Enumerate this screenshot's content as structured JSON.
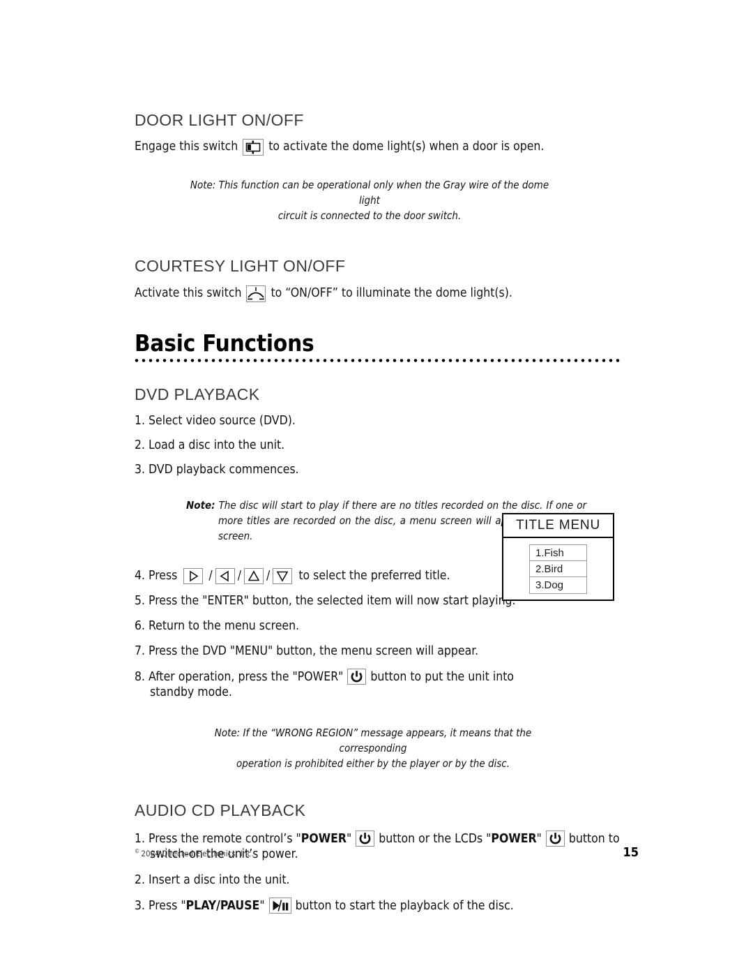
{
  "sections": {
    "door_light": {
      "heading": "DOOR LIGHT ON/OFF",
      "body_before": "Engage this switch",
      "icon": "door-light-switch-icon",
      "body_after": "to activate the dome light(s) when a door is open.",
      "note_line1": "Note: This function can be operational only when the Gray wire of the dome light",
      "note_line2": "circuit is connected to the door switch."
    },
    "courtesy_light": {
      "heading": "COURTESY LIGHT ON/OFF",
      "body_before": "Activate this switch",
      "icon": "courtesy-dome-light-icon",
      "body_after": "to “ON/OFF” to illuminate the dome light(s)."
    },
    "chapter": {
      "title": "Basic Functions"
    },
    "dvd_playback": {
      "heading": "DVD PLAYBACK",
      "steps_1_3": [
        "1. Select video source (DVD).",
        "2. Load a disc into the unit.",
        "3. DVD playback commences."
      ],
      "note_label": "Note:",
      "note_text": "The disc will start to play if there are no titles recorded on the disc. If one or more titles are recorded on the disc, a menu screen will appear on the LCD screen.",
      "step4_num": "4. Press",
      "step4_sep": "/",
      "step4_icons": [
        "arrow-right-icon",
        "arrow-left-icon",
        "arrow-up-icon",
        "arrow-down-icon"
      ],
      "step4_tail": "to select the preferred title.",
      "step5": "5. Press the \"ENTER\" button, the selected item will now start playing.",
      "step6": "6. Return to the menu screen.",
      "step7": "7. Press the DVD \"MENU\" button, the menu screen will appear.",
      "step8_before": "8. After operation, press the \"POWER\"",
      "step8_icon": "power-icon",
      "step8_after": "button to put the unit into standby mode.",
      "note2_line1": "Note: If the “WRONG REGION” message appears, it means that the corresponding",
      "note2_line2": "operation is prohibited either by the player or by the disc."
    },
    "title_menu": {
      "header": "TITLE MENU",
      "items": [
        "1.Fish",
        "2.Bird",
        "3.Dog"
      ]
    },
    "audio_cd": {
      "heading": "AUDIO CD PLAYBACK",
      "step1_a": "1. Press the remote control’s \"",
      "step1_power1": "POWER",
      "step1_b": "\"",
      "step1_icon1": "power-icon",
      "step1_c": "button or the LCDs \"",
      "step1_power2": "POWER",
      "step1_d": "\"",
      "step1_icon2": "power-icon",
      "step1_e": "button to switch-on the unit’s power.",
      "step2": "2. Insert a disc into the unit.",
      "step3_a": "3. Press \"",
      "step3_label": "PLAY/PAUSE",
      "step3_b": "\"",
      "step3_icon": "play-pause-icon",
      "step3_c": "button to start the playback of the disc."
    }
  },
  "footer": {
    "copyright_mark": "©",
    "copyright": "2004 Directed Electronics, Inc.",
    "page_number": "15"
  }
}
